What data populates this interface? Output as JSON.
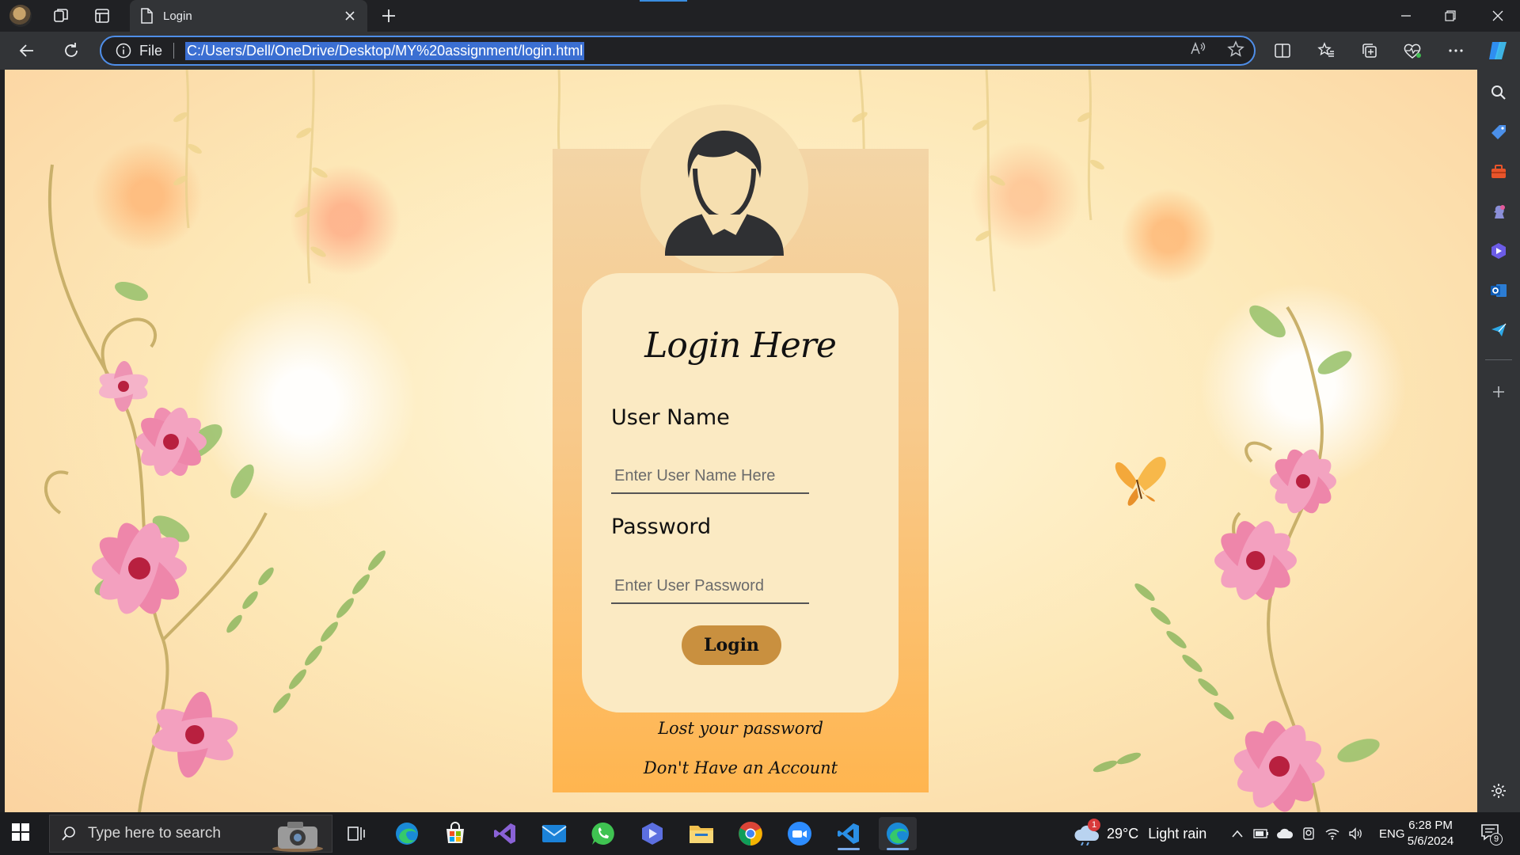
{
  "browser": {
    "tab": {
      "title": "Login"
    },
    "address": {
      "scheme_label": "File",
      "url": "C:/Users/Dell/OneDrive/Desktop/MY%20assignment/login.html"
    }
  },
  "login": {
    "title": "Login Here",
    "username_label": "User Name",
    "username_placeholder": "Enter User Name Here",
    "password_label": "Password",
    "password_placeholder": "Enter User Password",
    "login_button": "Login",
    "lost_password_link": "Lost your password",
    "no_account_link": "Don't Have an Account"
  },
  "sidebar": {
    "items": [
      "search-icon",
      "tag-icon",
      "toolbox-icon",
      "chess-icon",
      "copilot-icon",
      "outlook-icon",
      "send-icon",
      "plus-icon",
      "gear-icon"
    ]
  },
  "taskbar": {
    "search_placeholder": "Type here to search",
    "weather_temp": "29°C",
    "weather_text": "Light rain",
    "weather_badge": "1",
    "language": "ENG",
    "time": "6:28 PM",
    "date": "5/6/2024",
    "notification_count": "9"
  },
  "colors": {
    "accent": "#4f8ee8",
    "login_button": "#c9903f",
    "card_inner": "#fbeac3"
  }
}
